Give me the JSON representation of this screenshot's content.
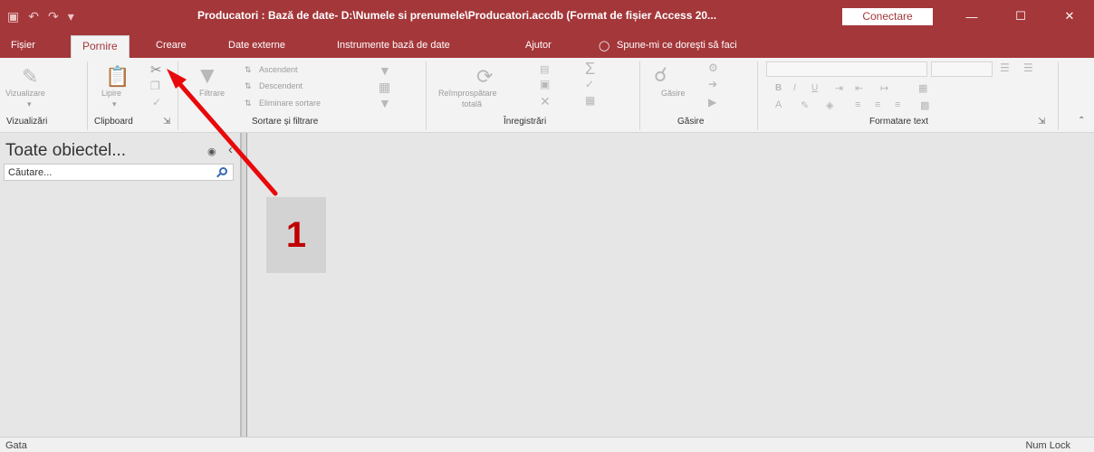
{
  "window": {
    "qat_icons": [
      "save-icon",
      "undo-icon",
      "redo-icon",
      "customize-icon"
    ],
    "title": "Producatori : Bază de date- D:\\Numele si prenumele\\Producatori.accdb (Format de fișier Access 20...",
    "signin_label": "Conectare"
  },
  "tabs": [
    "Fișier",
    "Pornire",
    "Creare",
    "Date externe",
    "Instrumente bază de date",
    "Ajutor",
    "Spune-mi ce doreşti să faci"
  ],
  "ribbon": {
    "view": {
      "button": "Vizualizare",
      "group": "Vizualizări"
    },
    "clipboard": {
      "paste": "Lipire",
      "group": "Clipboard"
    },
    "sort": {
      "filter": "Filtrare",
      "ascending": "Ascendent",
      "descending": "Descendent",
      "remove": "Eliminare sortare",
      "group": "Sortare și filtrare"
    },
    "records": {
      "refresh": "Reîmprospătare",
      "refresh2": "totală",
      "group": "Înregistrări"
    },
    "find": {
      "button": "Găsire",
      "group": "Găsire"
    },
    "text": {
      "group": "Formatare text"
    }
  },
  "nav": {
    "title": "Toate obiectel...",
    "search_placeholder": "Căutare..."
  },
  "status": {
    "left": "Gata",
    "right": "Num Lock"
  },
  "annotation": {
    "label": "1",
    "color": "#e8090a"
  },
  "colors": {
    "accent": "#a4373a"
  }
}
